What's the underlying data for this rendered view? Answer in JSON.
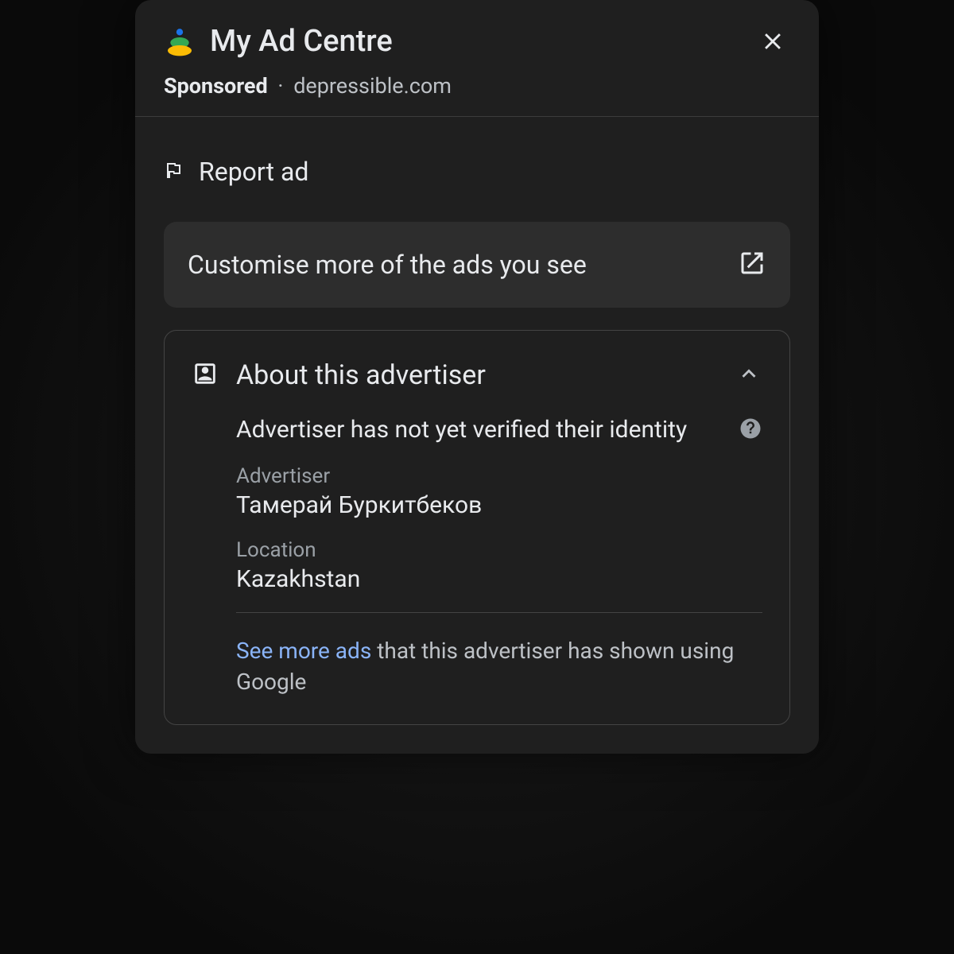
{
  "header": {
    "title": "My Ad Centre",
    "sponsored_label": "Sponsored",
    "domain": "depressible.com"
  },
  "report": {
    "label": "Report ad"
  },
  "customise": {
    "label": "Customise more of the ads you see"
  },
  "about": {
    "title": "About this advertiser",
    "verify_text": "Advertiser has not yet verified their identity",
    "advertiser_label": "Advertiser",
    "advertiser_value": "Тамерай Буркитбеков",
    "location_label": "Location",
    "location_value": "Kazakhstan",
    "see_more_link": "See more ads",
    "see_more_rest": " that this advertiser has shown using Google"
  }
}
